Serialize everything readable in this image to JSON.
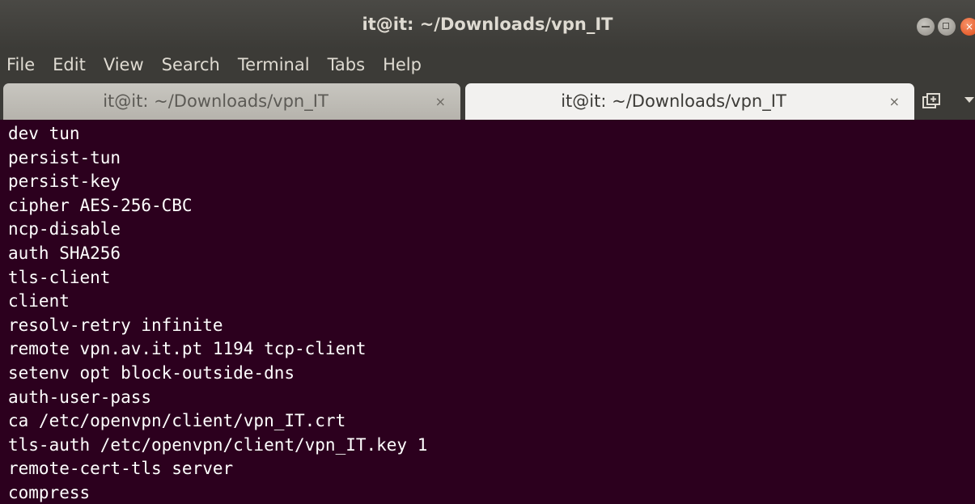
{
  "window": {
    "title": "it@it: ~/Downloads/vpn_IT"
  },
  "menu": {
    "items": [
      "File",
      "Edit",
      "View",
      "Search",
      "Terminal",
      "Tabs",
      "Help"
    ]
  },
  "tabs": [
    {
      "label": "it@it: ~/Downloads/vpn_IT",
      "active": false,
      "close_glyph": "×"
    },
    {
      "label": "it@it: ~/Downloads/vpn_IT",
      "active": true,
      "close_glyph": "×"
    }
  ],
  "terminal": {
    "lines": [
      "dev tun",
      "persist-tun",
      "persist-key",
      "cipher AES-256-CBC",
      "ncp-disable",
      "auth SHA256",
      "tls-client",
      "client",
      "resolv-retry infinite",
      "remote vpn.av.it.pt 1194 tcp-client",
      "setenv opt block-outside-dns",
      "auth-user-pass",
      "ca /etc/openvpn/client/vpn_IT.crt",
      "tls-auth /etc/openvpn/client/vpn_IT.key 1",
      "remote-cert-tls server",
      "compress"
    ]
  },
  "colors": {
    "terminal_bg": "#2c001e",
    "terminal_fg": "#ffffff",
    "chrome_bg": "#3c3b37",
    "close_button": "#df4a16"
  },
  "icons": {
    "minimize": "minimize-icon",
    "maximize": "maximize-icon",
    "close": "close-icon",
    "new_tab": "new-tab-icon",
    "tab_menu": "chevron-down-icon"
  }
}
